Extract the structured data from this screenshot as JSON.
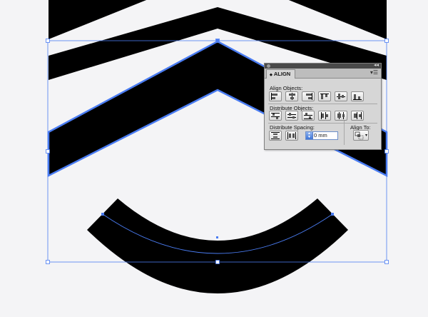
{
  "panel": {
    "tab_title": "ALIGN",
    "tab_arrow": "◆",
    "collapse_glyph": "◂◂",
    "menu_glyph": "▾☰",
    "align_objects_label": "Align Objects:",
    "distribute_objects_label": "Distribute Objects:",
    "distribute_spacing_label": "Distribute Spacing:",
    "align_to_label": "Align To:",
    "spacing_value": "0 mm",
    "align_objects_buttons": [
      "horizontal-align-left-icon",
      "horizontal-align-center-icon",
      "horizontal-align-right-icon",
      "vertical-align-top-icon",
      "vertical-align-center-icon",
      "vertical-align-bottom-icon"
    ],
    "distribute_objects_buttons": [
      "vertical-distribute-top-icon",
      "vertical-distribute-center-icon",
      "vertical-distribute-bottom-icon",
      "horizontal-distribute-left-icon",
      "horizontal-distribute-center-icon",
      "horizontal-distribute-right-icon"
    ],
    "distribute_spacing_buttons": [
      "vertical-distribute-space-icon",
      "horizontal-distribute-space-icon"
    ]
  },
  "colors": {
    "artwork_fill": "#000000",
    "selection_blue": "#4a7cf2",
    "canvas_bg": "#f4f4f6"
  }
}
